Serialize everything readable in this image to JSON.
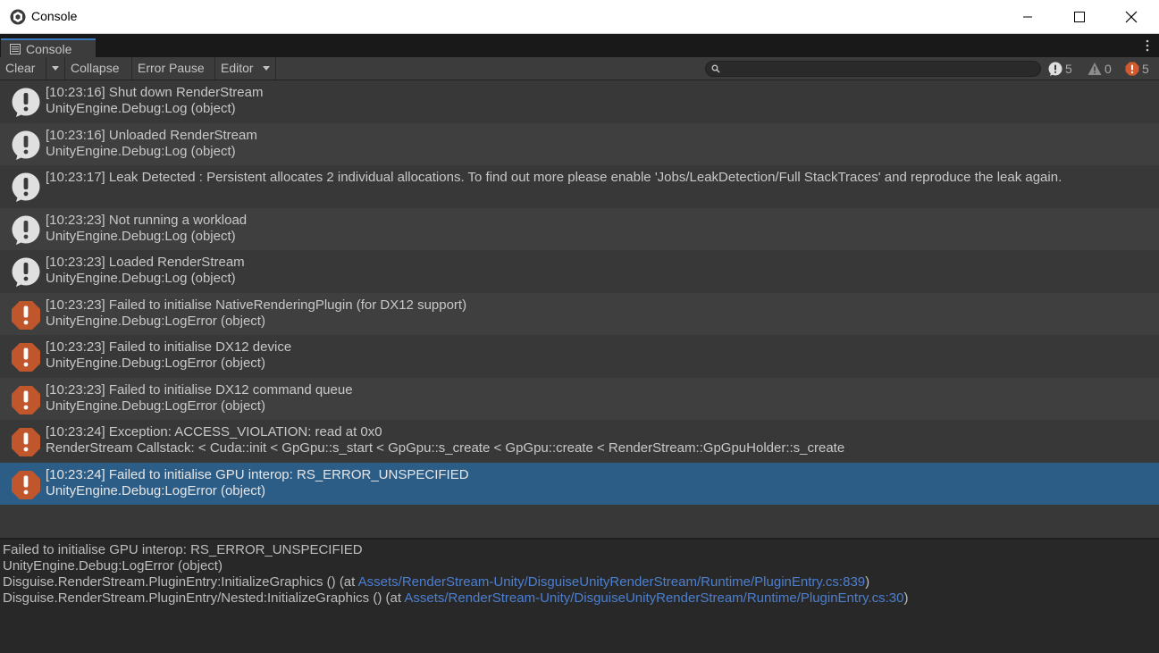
{
  "window": {
    "title": "Console"
  },
  "tab": {
    "label": "Console"
  },
  "toolbar": {
    "clear_label": "Clear",
    "collapse_label": "Collapse",
    "error_pause_label": "Error Pause",
    "editor_label": "Editor",
    "search_placeholder": "",
    "log_count": "5",
    "warning_count": "0",
    "error_count": "5"
  },
  "colors": {
    "info_icon": "#e0e0e0",
    "error_icon": "#c0562c",
    "selected_row": "#2c5d87",
    "link": "#4c7fd0"
  },
  "logs": [
    {
      "type": "info",
      "line1": "[10:23:16] Shut down RenderStream",
      "line2": "UnityEngine.Debug:Log (object)"
    },
    {
      "type": "info",
      "line1": "[10:23:16] Unloaded RenderStream",
      "line2": "UnityEngine.Debug:Log (object)"
    },
    {
      "type": "info",
      "line1": "[10:23:17] Leak Detected : Persistent allocates 2 individual allocations. To find out more please enable 'Jobs/LeakDetection/Full StackTraces' and reproduce the leak again.",
      "line2": ""
    },
    {
      "type": "info",
      "line1": "[10:23:23] Not running a workload",
      "line2": "UnityEngine.Debug:Log (object)"
    },
    {
      "type": "info",
      "line1": "[10:23:23] Loaded RenderStream",
      "line2": "UnityEngine.Debug:Log (object)"
    },
    {
      "type": "error",
      "line1": "[10:23:23] Failed to initialise NativeRenderingPlugin (for DX12 support)",
      "line2": "UnityEngine.Debug:LogError (object)"
    },
    {
      "type": "error",
      "line1": "[10:23:23] Failed to initialise DX12 device",
      "line2": "UnityEngine.Debug:LogError (object)"
    },
    {
      "type": "error",
      "line1": "[10:23:23] Failed to initialise DX12 command queue",
      "line2": "UnityEngine.Debug:LogError (object)"
    },
    {
      "type": "error",
      "line1": "[10:23:24] Exception: ACCESS_VIOLATION: read at 0x0",
      "line2": "RenderStream Callstack:  < Cuda::init < GpGpu::s_start < GpGpu::s_create < GpGpu::create < RenderStream::GpGpuHolder::s_create"
    },
    {
      "type": "error",
      "line1": "[10:23:24] Failed to initialise GPU interop: RS_ERROR_UNSPECIFIED",
      "line2": "UnityEngine.Debug:LogError (object)",
      "selected": true
    }
  ],
  "detail": {
    "line1": "Failed to initialise GPU interop: RS_ERROR_UNSPECIFIED",
    "line2": "UnityEngine.Debug:LogError (object)",
    "line3_prefix": "Disguise.RenderStream.PluginEntry:InitializeGraphics () (at ",
    "line3_link": "Assets/RenderStream-Unity/DisguiseUnityRenderStream/Runtime/PluginEntry.cs:839",
    "line3_suffix": ")",
    "line4_prefix": "Disguise.RenderStream.PluginEntry/Nested:InitializeGraphics () (at ",
    "line4_link": "Assets/RenderStream-Unity/DisguiseUnityRenderStream/Runtime/PluginEntry.cs:30",
    "line4_suffix": ")"
  }
}
